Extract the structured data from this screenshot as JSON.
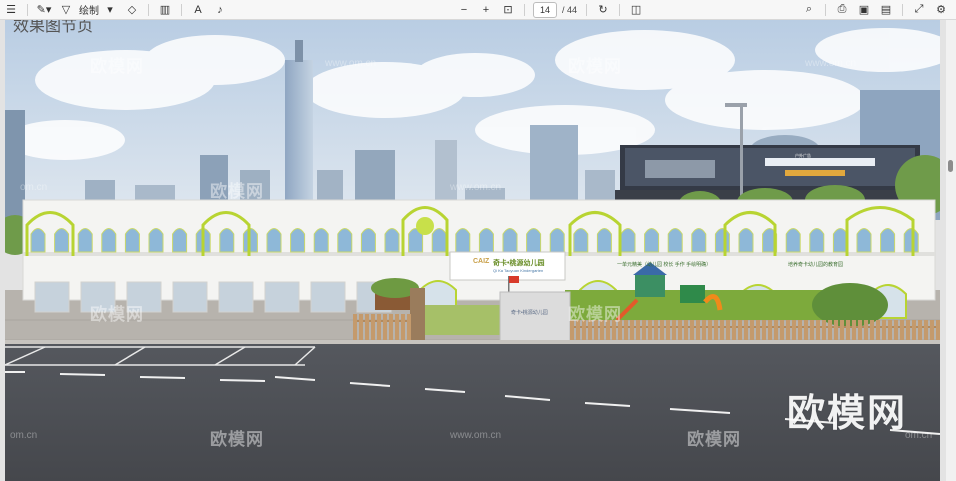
{
  "toolbar": {
    "draw_label": "绘制",
    "page_current": "14",
    "page_total": "/ 44",
    "icons": [
      "outline-icon",
      "highlight-icon",
      "draw-icon",
      "eraser-icon",
      "split-view-icon",
      "text-icon",
      "read-aloud-icon",
      "zoom-out-icon",
      "zoom-in-icon",
      "fit-page-icon",
      "rotate-icon",
      "two-page-icon",
      "search-icon",
      "print-icon",
      "save-icon",
      "save-as-icon",
      "fullscreen-icon",
      "settings-icon"
    ]
  },
  "page": {
    "heading_fragment": "效果图节页",
    "watermarks": {
      "brand": "欧模网",
      "site": "www.om.cn",
      "site_short": "om.cn"
    },
    "school_sign": {
      "logo": "CAIZ",
      "name": "奇卡•桃源幼儿园",
      "subtitle": "Qi Ka Taoyuan Kindergarten"
    },
    "facade_slogans": [
      "一单元精美（幼儿园 校长 手作 手绘明确）",
      "培养奇卡幼儿园的教育园"
    ],
    "gate_sign": "奇卡•桃源幼儿园",
    "billboard": "户外广告"
  },
  "colors": {
    "accent_green": "#b8d432",
    "sky": "#c7d6e8",
    "road": "#505258",
    "facade": "#f4f4f2"
  }
}
